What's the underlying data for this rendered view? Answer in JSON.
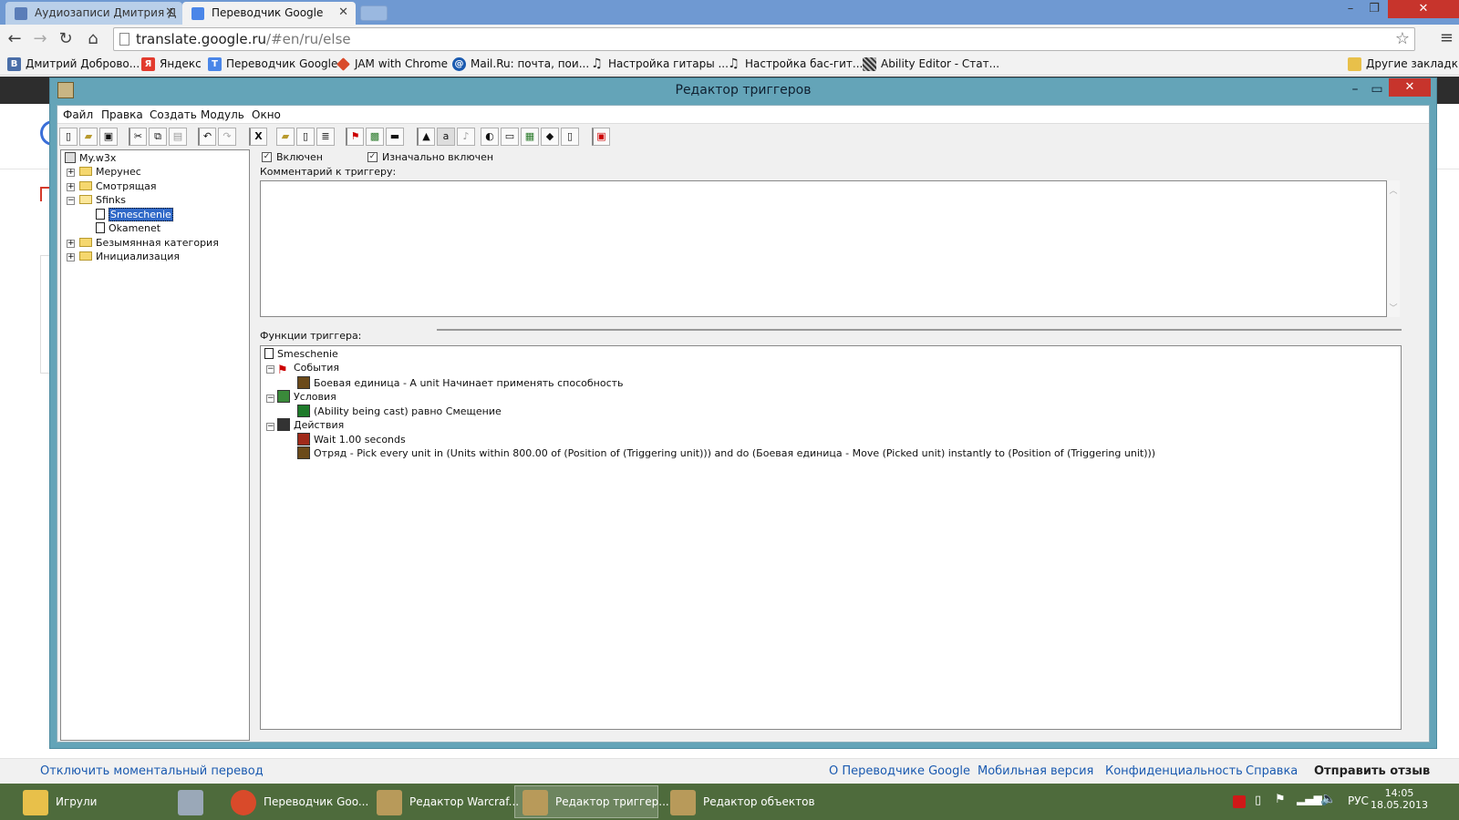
{
  "browser": {
    "tabs": [
      {
        "title": "Аудиозаписи Дмитрия Д",
        "active": false
      },
      {
        "title": "Переводчик Google",
        "active": true
      }
    ],
    "url_domain": "translate.google.ru",
    "url_rest": "/#en/ru/else",
    "bookmarks": [
      {
        "label": "Дмитрий Доброво...",
        "icon": "vk-icon",
        "color": "#4a6ea8"
      },
      {
        "label": "Яндекс",
        "icon": "yandex-icon",
        "color": "#e23b2e"
      },
      {
        "label": "Переводчик Google",
        "icon": "translate-icon",
        "color": "#4a86e8"
      },
      {
        "label": "JAM with Chrome",
        "icon": "jam-icon",
        "color": "#d94a2a"
      },
      {
        "label": "Mail.Ru: почта, пои...",
        "icon": "mailru-icon",
        "color": "#1a5ab0"
      },
      {
        "label": "Настройка гитары ...",
        "icon": "music-note-icon",
        "color": "#333333"
      },
      {
        "label": "Настройка бас-гит...",
        "icon": "music-note-icon",
        "color": "#333333"
      },
      {
        "label": "Ability Editor - Стат...",
        "icon": "ability-icon",
        "color": "#444444"
      }
    ],
    "other_bookmarks": "Другие закладки"
  },
  "google_footer": {
    "left": "Отключить моментальный перевод",
    "links": [
      "О Переводчике Google",
      "Мобильная версия",
      "Конфиденциальность",
      "Справка"
    ],
    "feedback": "Отправить отзыв"
  },
  "editor": {
    "title": "Редактор триггеров",
    "menu": [
      "Файл",
      "Правка",
      "Создать",
      "Модуль",
      "Окно"
    ],
    "tree": {
      "root": "My.w3x",
      "items": [
        {
          "label": "Мерунес",
          "type": "folder",
          "expanded": false
        },
        {
          "label": "Смотрящая",
          "type": "folder",
          "expanded": false
        },
        {
          "label": "Sfinks",
          "type": "folder",
          "expanded": true
        },
        {
          "label": "Smeschenie",
          "type": "trigger",
          "selected": true
        },
        {
          "label": "Okamenet",
          "type": "trigger"
        },
        {
          "label": "Безымянная категория",
          "type": "folder",
          "expanded": false
        },
        {
          "label": "Инициализация",
          "type": "folder",
          "expanded": false
        }
      ]
    },
    "enabled_label": "Включен",
    "initially_enabled_label": "Изначально включен",
    "comment_label": "Комментарий к триггеру:",
    "functions_label": "Функции триггера:",
    "functions": {
      "trigger_name": "Smeschenie",
      "events_label": "События",
      "event": "Боевая единица - A unit Начинает применять способность",
      "conditions_label": "Условия",
      "condition": "(Ability being cast) равно Смещение",
      "actions_label": "Действия",
      "action1": "Wait 1.00 seconds",
      "action2": "Отряд - Pick every unit in (Units within 800.00 of (Position of (Triggering unit))) and do (Боевая единица - Move (Picked unit) instantly to (Position of (Triggering unit)))"
    }
  },
  "taskbar": {
    "items": [
      {
        "label": "Игрули",
        "icon": "folder-icon",
        "color": "#e8c04a"
      },
      {
        "label": "",
        "icon": "calculator-icon",
        "color": "#9aa8b8"
      },
      {
        "label": "Переводчик Goo...",
        "icon": "chrome-icon",
        "color": "#d94a2a"
      },
      {
        "label": "Редактор Warcraf...",
        "icon": "warcraft-icon",
        "color": "#b89a5a"
      },
      {
        "label": "Редактор триггер...",
        "icon": "warcraft-icon",
        "color": "#b89a5a",
        "active": true
      },
      {
        "label": "Редактор объектов",
        "icon": "warcraft-icon",
        "color": "#b89a5a"
      }
    ],
    "lang": "РУС",
    "time": "14:05",
    "date": "18.05.2013"
  }
}
